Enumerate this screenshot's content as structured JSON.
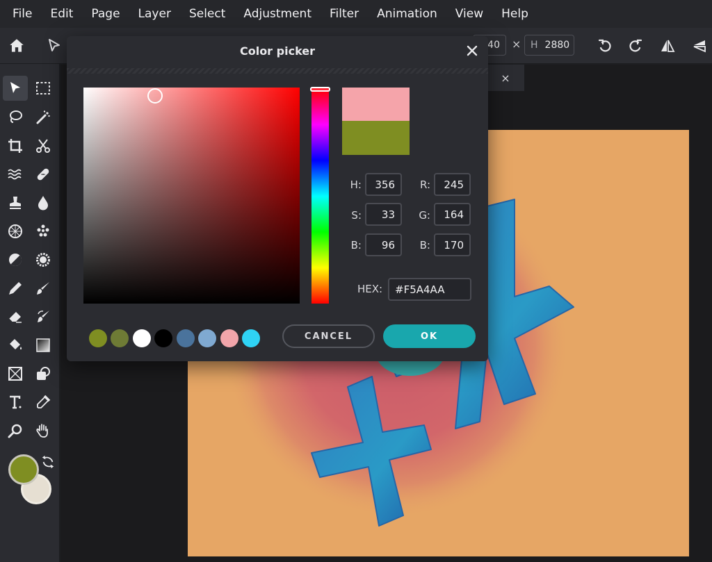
{
  "menu": [
    "File",
    "Edit",
    "Page",
    "Layer",
    "Select",
    "Adjustment",
    "Filter",
    "Animation",
    "View",
    "Help"
  ],
  "toolbar": {
    "width_value": "40",
    "height_label": "H",
    "height_value": "2880",
    "times_sign": "×"
  },
  "document_tab": {
    "close": "×"
  },
  "tools": [
    "arrow-select",
    "marquee",
    "lasso",
    "magic-wand",
    "crop",
    "cut",
    "liquify",
    "heal",
    "stamp",
    "drop",
    "sphere-filter",
    "dots-filter",
    "dodge-burn",
    "sponge",
    "pencil",
    "brush",
    "eraser",
    "color-replace",
    "fill",
    "gradient",
    "shape",
    "ellipse-shape",
    "text",
    "eyedropper",
    "zoom",
    "hand"
  ],
  "colors": {
    "foreground": "#7f8e22",
    "background": "#e6dfd2",
    "canvas": "#e6a665",
    "accent": "#19a7ad"
  },
  "dialog": {
    "title": "Color picker",
    "close": "×",
    "new_color": "#f5a4aa",
    "old_color": "#7f8e22",
    "fields": {
      "h": {
        "label": "H:",
        "value": "356"
      },
      "s": {
        "label": "S:",
        "value": "33"
      },
      "bv": {
        "label": "B:",
        "value": "96"
      },
      "r": {
        "label": "R:",
        "value": "245"
      },
      "g": {
        "label": "G:",
        "value": "164"
      },
      "b": {
        "label": "B:",
        "value": "170"
      }
    },
    "hex_label": "HEX:",
    "hex_value": "#F5A4AA",
    "swatches": [
      "#7f8e22",
      "#6e7b35",
      "#ffffff",
      "#000000",
      "#4a739c",
      "#7fa9d1",
      "#f2a5aa",
      "#2fd3f5"
    ],
    "cancel_label": "CANCEL",
    "ok_label": "OK"
  }
}
